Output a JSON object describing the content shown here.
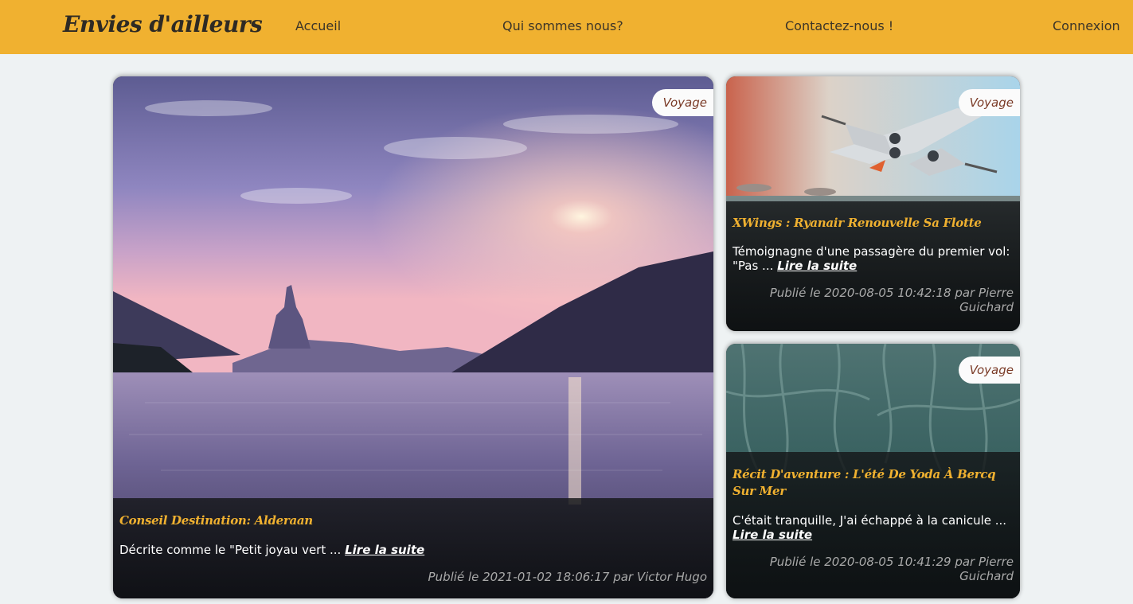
{
  "header": {
    "logo": "Envies d'ailleurs",
    "nav": [
      "Accueil",
      "Qui sommes nous?",
      "Contactez-nous !",
      "Connexion"
    ]
  },
  "articles": [
    {
      "category": "Voyage",
      "title": "Conseil Destination: Alderaan",
      "excerpt": "Décrite comme le \"Petit joyau vert ...",
      "read_more": "Lire la suite",
      "meta": "Publié le 2021-01-02 18:06:17 par Victor Hugo"
    },
    {
      "category": "Voyage",
      "title": "XWings : Ryanair Renouvelle Sa Flotte",
      "excerpt": "Témoignagne d'une passagère du premier vol: \"Pas ...",
      "read_more": "Lire la suite",
      "meta": "Publié le 2020-08-05 10:42:18 par Pierre Guichard"
    },
    {
      "category": "Voyage",
      "title": "Récit D'aventure : L'été De Yoda À Bercq Sur Mer",
      "excerpt": "C'était tranquille, J'ai échappé à la canicule ...",
      "read_more": "Lire la suite",
      "meta": "Publié le 2020-08-05 10:41:29 par Pierre Guichard"
    }
  ],
  "colors": {
    "accent": "#f0b130",
    "background": "#eef2f3",
    "badge_text": "#7a3a26",
    "meta_text": "#a9a9a9"
  }
}
